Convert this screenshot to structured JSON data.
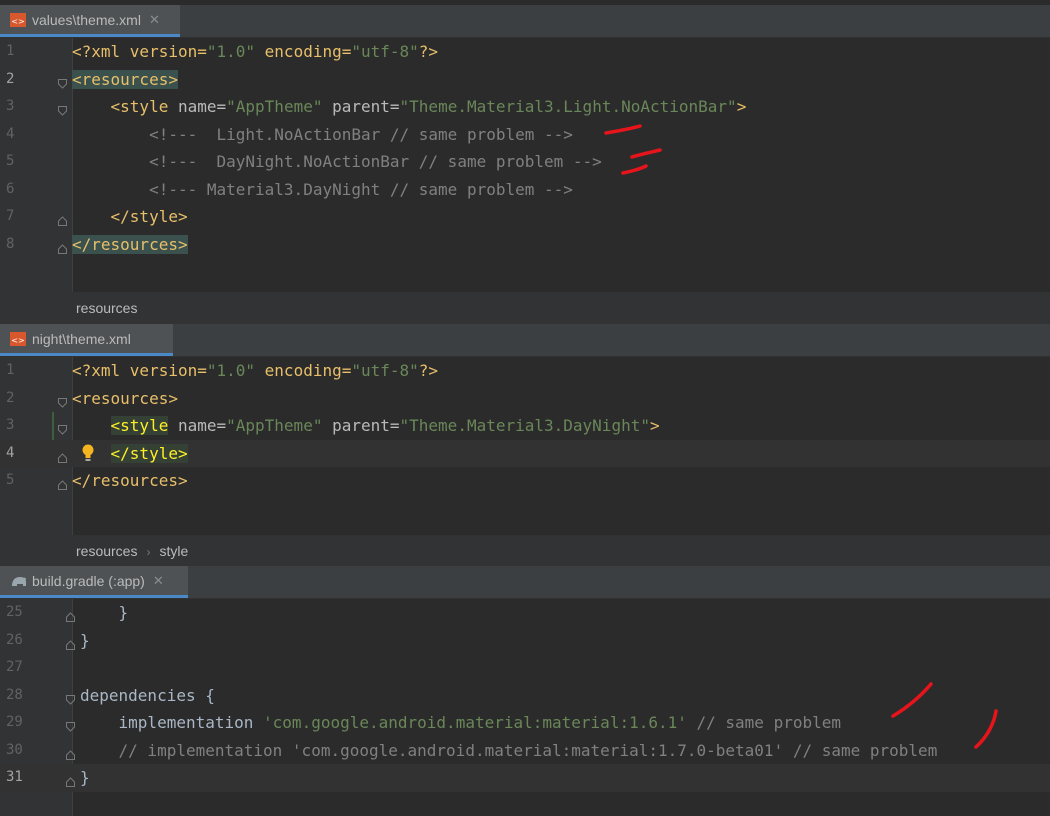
{
  "tabs": [
    {
      "name": "values\\theme.xml",
      "close": "✕"
    },
    {
      "name": "night\\theme.xml",
      "close": ""
    },
    {
      "name": "build.gradle (:app)",
      "close": "✕"
    }
  ],
  "editor1": {
    "lines": [
      {
        "num": "1",
        "parts": [
          "<?xml version=",
          "\"1.0\"",
          " encoding=",
          "\"utf-8\"",
          "?>"
        ]
      },
      {
        "num": "2",
        "parts": [
          "<resources>"
        ]
      },
      {
        "num": "3",
        "parts": [
          "    ",
          "<style ",
          "name=",
          "\"AppTheme\"",
          " parent=",
          "\"Theme.Material3.Light.NoActionBar\"",
          ">"
        ]
      },
      {
        "num": "4",
        "parts": [
          "        <!---  Light.NoActionBar // same problem -->"
        ]
      },
      {
        "num": "5",
        "parts": [
          "        <!---  DayNight.NoActionBar // same problem -->"
        ]
      },
      {
        "num": "6",
        "parts": [
          "        <!--- Material3.DayNight // same problem -->"
        ]
      },
      {
        "num": "7",
        "parts": [
          "    ",
          "</style>"
        ]
      },
      {
        "num": "8",
        "parts": [
          "</resources>"
        ]
      }
    ],
    "breadcrumb": [
      "resources"
    ]
  },
  "editor2": {
    "lines": [
      {
        "num": "1",
        "parts": [
          "<?xml version=",
          "\"1.0\"",
          " encoding=",
          "\"utf-8\"",
          "?>"
        ]
      },
      {
        "num": "2",
        "parts": [
          "<resources>"
        ]
      },
      {
        "num": "3",
        "parts": [
          "    ",
          "<style",
          " name=",
          "\"AppTheme\"",
          " parent=",
          "\"Theme.Material3.DayNight\"",
          ">"
        ]
      },
      {
        "num": "4",
        "parts": [
          "    ",
          "</style>"
        ]
      },
      {
        "num": "5",
        "parts": [
          "</resources>"
        ]
      }
    ],
    "breadcrumb": [
      "resources",
      "style"
    ],
    "breadcrumb_sep": "›"
  },
  "editor3": {
    "lines": [
      {
        "num": "25",
        "parts": [
          "    }"
        ]
      },
      {
        "num": "26",
        "parts": [
          "}"
        ]
      },
      {
        "num": "27",
        "parts": [
          ""
        ]
      },
      {
        "num": "28",
        "parts": [
          "dependencies {"
        ]
      },
      {
        "num": "29",
        "parts": [
          "    implementation ",
          "'com.google.android.material:material:1.6.1'",
          " // same problem"
        ]
      },
      {
        "num": "30",
        "parts": [
          "    // implementation 'com.google.android.material:material:1.7.0-beta01' // same problem"
        ]
      },
      {
        "num": "31",
        "parts": [
          "}"
        ]
      }
    ]
  },
  "colors": {
    "background": "#2b2b2b",
    "gutter": "#313335",
    "tag": "#e8bf6a",
    "string": "#6a8759",
    "comment": "#808080",
    "annotation": "#e8141c"
  },
  "icons": {
    "xml_file": "xml-file-icon",
    "gradle_file": "gradle-elephant-icon",
    "intention": "lightbulb-icon"
  }
}
